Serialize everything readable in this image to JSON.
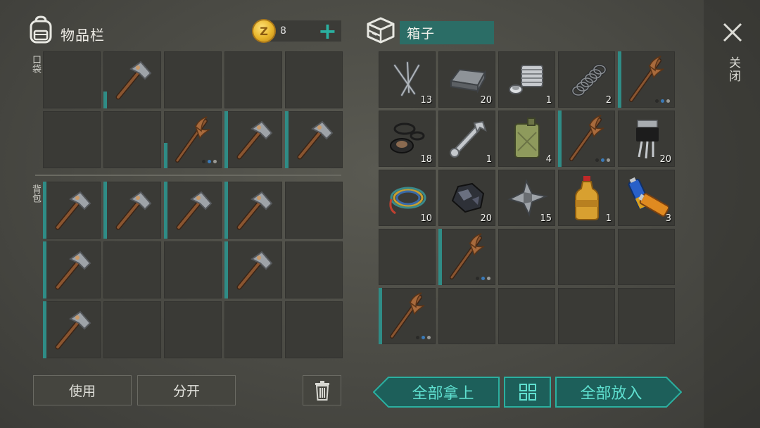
{
  "inventory": {
    "title": "物品栏",
    "pocket_label": "口袋",
    "backpack_label": "背包",
    "coins": "8",
    "pocket": [
      {
        "item": "",
        "qty": "",
        "dur": 0
      },
      {
        "item": "hammer",
        "qty": "",
        "dur": 0.3
      },
      {
        "item": "",
        "qty": "",
        "dur": 0
      },
      {
        "item": "",
        "qty": "",
        "dur": 0
      },
      {
        "item": "",
        "qty": "",
        "dur": 0
      },
      {
        "item": "",
        "qty": "",
        "dur": 0
      },
      {
        "item": "",
        "qty": "",
        "dur": 0
      },
      {
        "item": "pickaxe",
        "qty": "",
        "dur": 0.45,
        "dots": true
      },
      {
        "item": "hammer",
        "qty": "",
        "dur": 1
      },
      {
        "item": "hammer",
        "qty": "",
        "dur": 1
      }
    ],
    "backpack": [
      {
        "item": "hammer",
        "qty": "",
        "dur": 1
      },
      {
        "item": "hammer",
        "qty": "",
        "dur": 1
      },
      {
        "item": "hammer",
        "qty": "",
        "dur": 1
      },
      {
        "item": "hammer",
        "qty": "",
        "dur": 1
      },
      {
        "item": "",
        "qty": "",
        "dur": 0
      },
      {
        "item": "hammer",
        "qty": "",
        "dur": 1
      },
      {
        "item": "",
        "qty": "",
        "dur": 0
      },
      {
        "item": "",
        "qty": "",
        "dur": 0
      },
      {
        "item": "hammer",
        "qty": "",
        "dur": 1
      },
      {
        "item": "",
        "qty": "",
        "dur": 0
      },
      {
        "item": "hammer",
        "qty": "",
        "dur": 1
      },
      {
        "item": "",
        "qty": "",
        "dur": 0
      },
      {
        "item": "",
        "qty": "",
        "dur": 0
      },
      {
        "item": "",
        "qty": "",
        "dur": 0
      },
      {
        "item": "",
        "qty": "",
        "dur": 0
      }
    ],
    "use_label": "使用",
    "split_label": "分开"
  },
  "chest": {
    "title": "箱子",
    "slots": [
      {
        "item": "nails",
        "qty": "13",
        "dur": 0
      },
      {
        "item": "iron-bar",
        "qty": "20",
        "dur": 0
      },
      {
        "item": "engine-part",
        "qty": "1",
        "dur": 0
      },
      {
        "item": "spring",
        "qty": "2",
        "dur": 0
      },
      {
        "item": "pickaxe",
        "qty": "",
        "dur": 1,
        "dots": true
      },
      {
        "item": "rubber-rings",
        "qty": "18",
        "dur": 0
      },
      {
        "item": "wrench",
        "qty": "1",
        "dur": 0
      },
      {
        "item": "jerrycan",
        "qty": "4",
        "dur": 0
      },
      {
        "item": "pickaxe",
        "qty": "",
        "dur": 1,
        "dots": true
      },
      {
        "item": "transistor",
        "qty": "20",
        "dur": 0
      },
      {
        "item": "wire",
        "qty": "10",
        "dur": 0
      },
      {
        "item": "coal",
        "qty": "20",
        "dur": 0
      },
      {
        "item": "scrap-metal",
        "qty": "15",
        "dur": 0
      },
      {
        "item": "bottle",
        "qty": "1",
        "dur": 0
      },
      {
        "item": "batteries",
        "qty": "3",
        "dur": 0
      },
      {
        "item": "",
        "qty": "",
        "dur": 0
      },
      {
        "item": "pickaxe",
        "qty": "",
        "dur": 1,
        "dots": true
      },
      {
        "item": "",
        "qty": "",
        "dur": 0
      },
      {
        "item": "",
        "qty": "",
        "dur": 0
      },
      {
        "item": "",
        "qty": "",
        "dur": 0
      },
      {
        "item": "pickaxe",
        "qty": "",
        "dur": 1,
        "dots": true
      },
      {
        "item": "",
        "qty": "",
        "dur": 0
      },
      {
        "item": "",
        "qty": "",
        "dur": 0
      },
      {
        "item": "",
        "qty": "",
        "dur": 0
      },
      {
        "item": "",
        "qty": "",
        "dur": 0
      }
    ],
    "take_all_label": "全部拿上",
    "put_all_label": "全部放入"
  },
  "close_label": "关闭",
  "icons": {
    "backpack": "backpack-icon",
    "coin": "coin-icon",
    "plus": "plus-icon",
    "chest": "chest-icon",
    "close": "close-icon",
    "trash": "trash-icon",
    "sort": "sort-grid-icon"
  },
  "colors": {
    "accent": "#2ab0a0",
    "durability": "#2f8c86",
    "slot": "#3a3a36"
  }
}
